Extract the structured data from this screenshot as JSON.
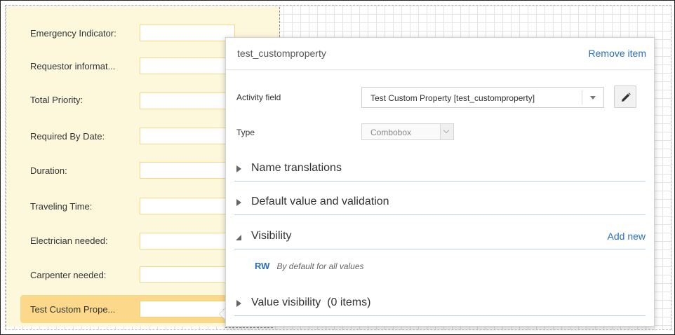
{
  "form_fields": [
    {
      "label": "Emergency Indicator:"
    },
    {
      "label": "Requestor informat..."
    },
    {
      "label": "Total Priority:"
    },
    {
      "label": "Required By Date:"
    },
    {
      "label": "Duration:"
    },
    {
      "label": "Traveling Time:"
    },
    {
      "label": "Electrician needed:"
    },
    {
      "label": "Carpenter needed:"
    },
    {
      "label": "Test Custom Prope...",
      "selected": true
    }
  ],
  "popup": {
    "title": "test_customproperty",
    "remove_label": "Remove item",
    "activity_field_label": "Activity field",
    "activity_field_value": "Test Custom Property [test_customproperty]",
    "edit_icon": "pencil-icon",
    "type_label": "Type",
    "type_value": "Combobox",
    "sections": {
      "name_translations": "Name translations",
      "default_value": "Default value and validation",
      "visibility": "Visibility",
      "value_visibility": "Value visibility  (0 items)"
    },
    "add_new_label": "Add new",
    "visibility_row": {
      "code": "RW",
      "description": "By default for all values"
    }
  },
  "colors": {
    "form_bg": "#fdf8dc",
    "selected_row": "#fcd98a",
    "input_border": "#f2d98a",
    "link": "#2a6ebb",
    "section_rule": "#b7d1ec"
  }
}
